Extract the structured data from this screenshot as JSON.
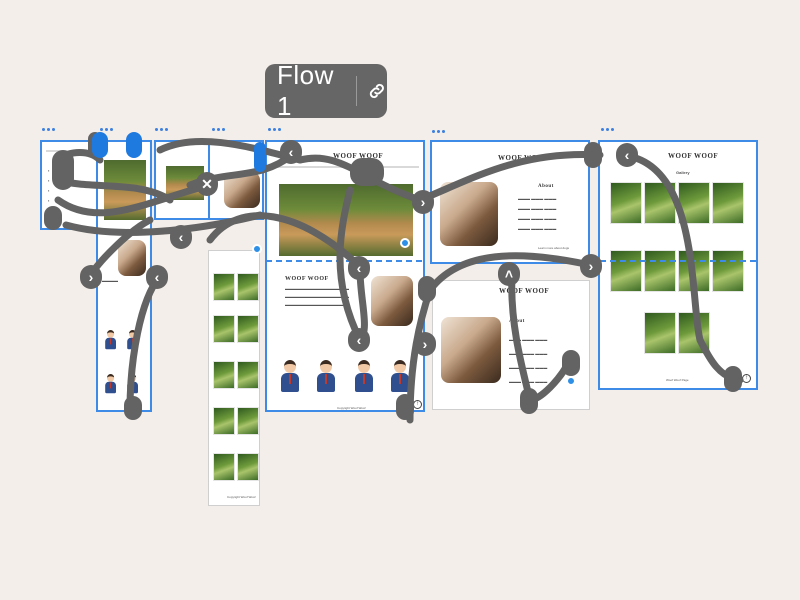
{
  "flow": {
    "label": "Flow 1"
  },
  "frames": {
    "tablet": {
      "title": "WOOF WOOF"
    },
    "desktop_main": {
      "title": "WOOF WOOF",
      "intro": "WOOF WOOF",
      "footer": "Copyright Woof Woof"
    },
    "desktop_profile": {
      "title": "WOOF WOOF",
      "heading": "About",
      "link": "Learn more about dogs"
    },
    "desktop_profile2": {
      "title": "WOOF WOOF",
      "heading": "About"
    },
    "desktop_gallery": {
      "title": "WOOF WOOF",
      "heading": "Gallery",
      "footer": "Woof Woof Page"
    },
    "mobile_gallery": {
      "footer": "Copyright Woof Woof"
    }
  },
  "colors": {
    "selection": "#3d8be6",
    "canvas": "#f4eeea",
    "chip": "#666666",
    "connector": "#636363"
  },
  "icons": [
    "link-icon",
    "chevron-left-icon",
    "chevron-right-icon",
    "chevron-up-icon",
    "close-icon",
    "arrow-up-icon",
    "more-icon"
  ]
}
